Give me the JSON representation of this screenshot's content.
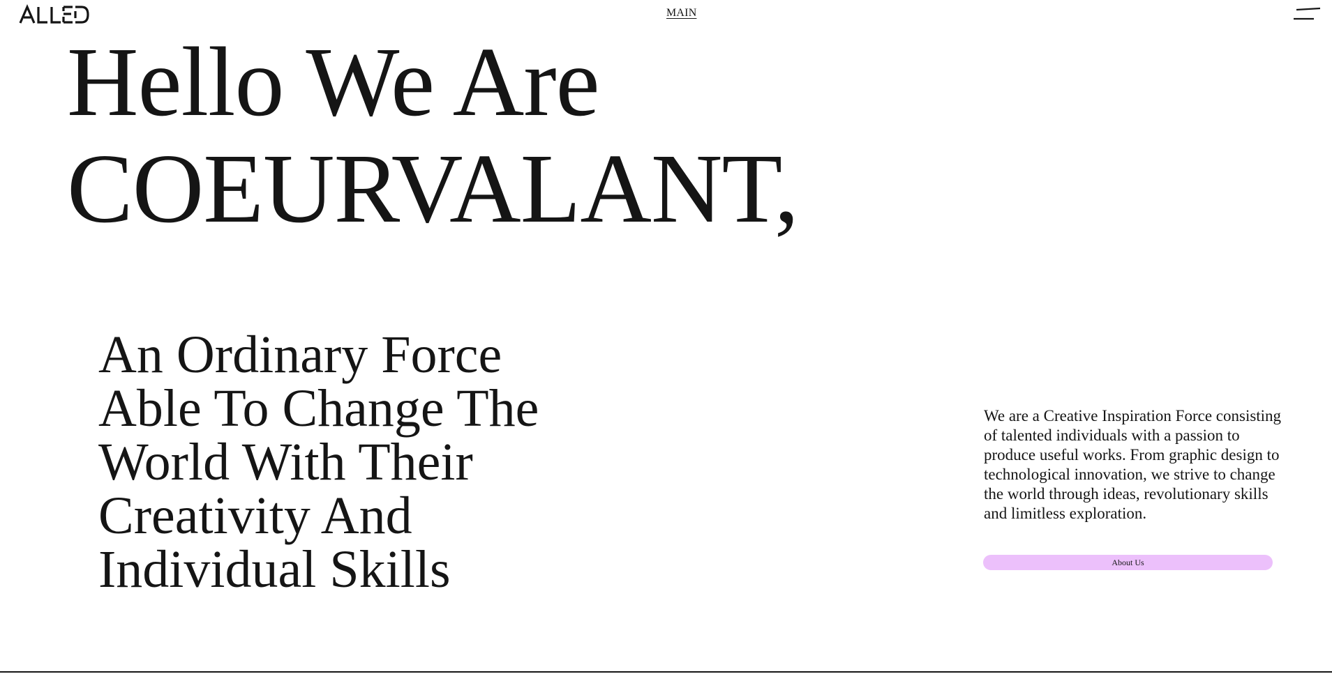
{
  "header": {
    "logo_text": "ALLED",
    "nav_main_label": "MAIN",
    "menu_icon": "hamburger-icon"
  },
  "hero": {
    "line1": "Hello We Are",
    "line2": "COEURVALANT,"
  },
  "tagline": {
    "lines": [
      "An Ordinary Force",
      "Able To Change The",
      "World With Their",
      "Creativity And",
      "Individual Skills"
    ]
  },
  "intro": {
    "text": "We are a Creative Inspiration Force consisting of talented individuals with a passion to produce useful works. From graphic design to technological innovation, we strive to change the world through ideas, revolutionary skills and limitless exploration.",
    "button_label": "About Us"
  },
  "colors": {
    "text": "#151515",
    "background": "#ffffff",
    "button_accent": "#ecc0fb"
  }
}
